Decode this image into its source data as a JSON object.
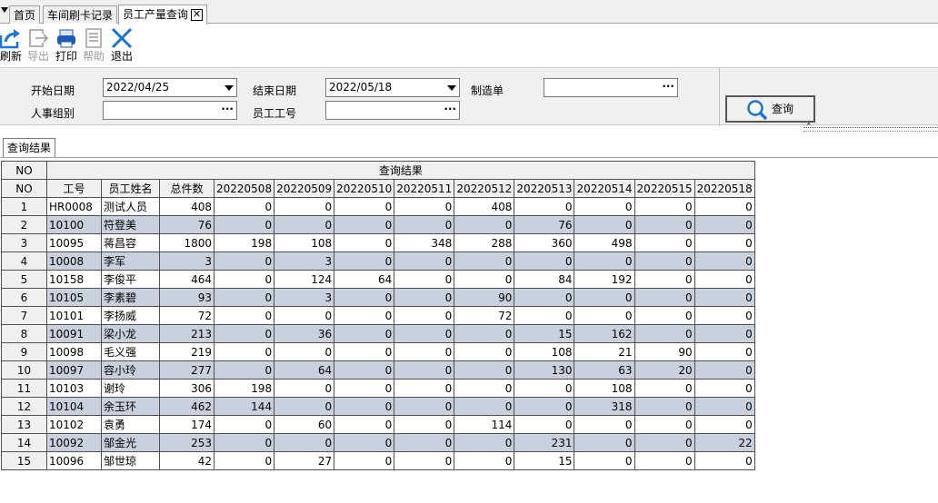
{
  "tabs": [
    {
      "label": "首页"
    },
    {
      "label": "车间刷卡记录"
    },
    {
      "label": "员工产量查询"
    }
  ],
  "toolbar": {
    "refresh": "刷新",
    "export": "导出",
    "print": "打印",
    "help": "帮助",
    "exit": "退出"
  },
  "form": {
    "start_date_label": "开始日期",
    "start_date_value": "2022/04/25",
    "end_date_label": "结束日期",
    "end_date_value": "2022/05/18",
    "order_label": "制造单",
    "order_value": "",
    "group_label": "人事组别",
    "group_value": "",
    "emp_no_label": "员工工号",
    "emp_no_value": "",
    "ellipsis": "···",
    "query_button": "查询"
  },
  "result_tab": "查询结果",
  "grid": {
    "top_no": "NO",
    "group_header": "查询结果",
    "columns": [
      "NO",
      "工号",
      "员工姓名",
      "总件数",
      "20220508",
      "20220509",
      "20220510",
      "20220511",
      "20220512",
      "20220513",
      "20220514",
      "20220515",
      "20220518"
    ],
    "rows": [
      [
        "1",
        "HR0008",
        "测试人员",
        "408",
        "0",
        "0",
        "0",
        "0",
        "408",
        "0",
        "0",
        "0",
        "0"
      ],
      [
        "2",
        "10100",
        "符登美",
        "76",
        "0",
        "0",
        "0",
        "0",
        "0",
        "76",
        "0",
        "0",
        "0"
      ],
      [
        "3",
        "10095",
        "蒋昌容",
        "1800",
        "198",
        "108",
        "0",
        "348",
        "288",
        "360",
        "498",
        "0",
        "0"
      ],
      [
        "4",
        "10008",
        "李军",
        "3",
        "0",
        "3",
        "0",
        "0",
        "0",
        "0",
        "0",
        "0",
        "0"
      ],
      [
        "5",
        "10158",
        "李俊平",
        "464",
        "0",
        "124",
        "64",
        "0",
        "0",
        "84",
        "192",
        "0",
        "0"
      ],
      [
        "6",
        "10105",
        "李素碧",
        "93",
        "0",
        "3",
        "0",
        "0",
        "90",
        "0",
        "0",
        "0",
        "0"
      ],
      [
        "7",
        "10101",
        "李扬威",
        "72",
        "0",
        "0",
        "0",
        "0",
        "72",
        "0",
        "0",
        "0",
        "0"
      ],
      [
        "8",
        "10091",
        "梁小龙",
        "213",
        "0",
        "36",
        "0",
        "0",
        "0",
        "15",
        "162",
        "0",
        "0"
      ],
      [
        "9",
        "10098",
        "毛义强",
        "219",
        "0",
        "0",
        "0",
        "0",
        "0",
        "108",
        "21",
        "90",
        "0"
      ],
      [
        "10",
        "10097",
        "容小玲",
        "277",
        "0",
        "64",
        "0",
        "0",
        "0",
        "130",
        "63",
        "20",
        "0"
      ],
      [
        "11",
        "10103",
        "谢玲",
        "306",
        "198",
        "0",
        "0",
        "0",
        "0",
        "0",
        "108",
        "0",
        "0"
      ],
      [
        "12",
        "10104",
        "余玉环",
        "462",
        "144",
        "0",
        "0",
        "0",
        "0",
        "0",
        "318",
        "0",
        "0"
      ],
      [
        "13",
        "10102",
        "袁勇",
        "174",
        "0",
        "60",
        "0",
        "0",
        "114",
        "0",
        "0",
        "0",
        "0"
      ],
      [
        "14",
        "10092",
        "邹金光",
        "253",
        "0",
        "0",
        "0",
        "0",
        "0",
        "231",
        "0",
        "0",
        "22"
      ],
      [
        "15",
        "10096",
        "邹世琼",
        "42",
        "0",
        "27",
        "0",
        "0",
        "0",
        "15",
        "0",
        "0",
        "0"
      ]
    ]
  },
  "colors": {
    "alt_row": "#c8d2de",
    "accent_icon": "#1e73d2",
    "panel": "#f0f0f0"
  }
}
